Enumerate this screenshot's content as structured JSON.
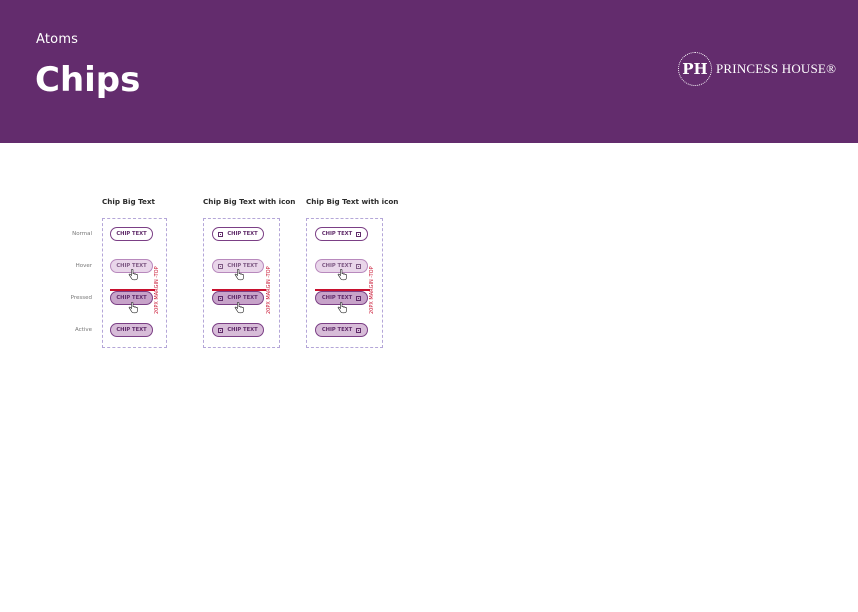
{
  "header": {
    "eyebrow": "Atoms",
    "title": "Chips",
    "brand_mono": "PH",
    "brand_name": "PRINCESS HOUSE®"
  },
  "states": [
    "Normal",
    "Hover",
    "Pressed",
    "Active"
  ],
  "columns": [
    {
      "title": "Chip Big Text",
      "icon": "none"
    },
    {
      "title": "Chip Big Text with icon",
      "icon": "leading"
    },
    {
      "title": "Chip Big Text with icon",
      "icon": "trailing"
    }
  ],
  "chip_label": "CHIP TEXT",
  "margin_note": "20PX MARGIN -TOP",
  "colors": {
    "header_bg": "#632c6d",
    "chip_border": "#7b3f85",
    "chip_hover": "#e9d6ea",
    "chip_pressed": "#c7a3c9",
    "chip_active": "#d7bcd8",
    "frame_border": "#b4a6d8",
    "redline": "#c8102e"
  },
  "icons": {
    "chip_icon": "square-icon",
    "cursor": "hand-pointer-icon"
  }
}
